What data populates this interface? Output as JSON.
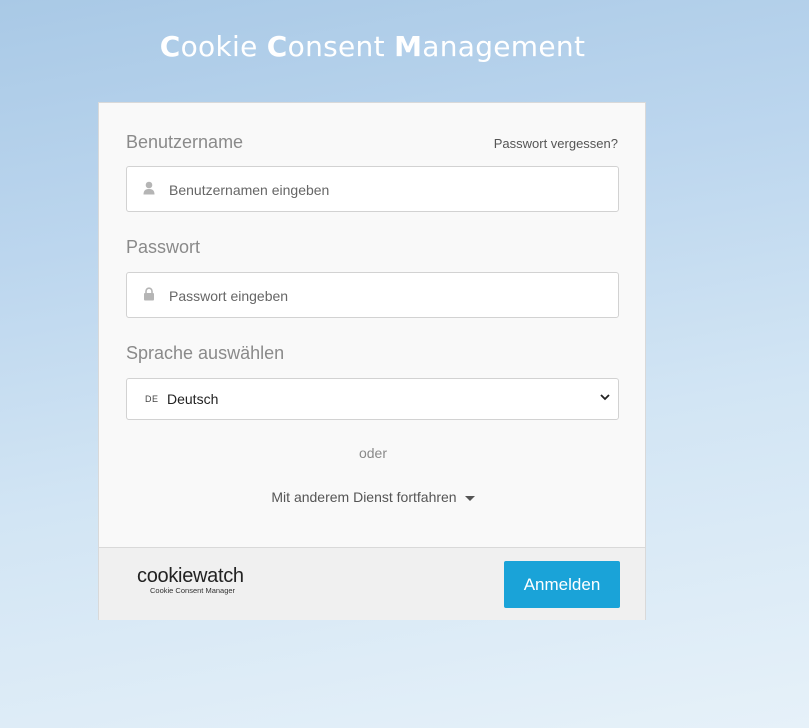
{
  "header": {
    "title_parts": [
      {
        "bold": "C",
        "rest": "ookie "
      },
      {
        "bold": "C",
        "rest": "onsent "
      },
      {
        "bold": "M",
        "rest": "anagement"
      }
    ]
  },
  "form": {
    "username_label": "Benutzername",
    "forgot_password": "Passwort vergessen?",
    "username_placeholder": "Benutzernamen eingeben",
    "password_label": "Passwort",
    "password_placeholder": "Passwort eingeben",
    "language_label": "Sprache auswählen",
    "language_flag": "DE",
    "language_value": "Deutsch",
    "or_text": "oder",
    "other_service": "Mit anderem Dienst fortfahren"
  },
  "footer": {
    "logo_main": "cookiewatch",
    "logo_sub": "Cookie Consent Manager",
    "login_button": "Anmelden",
    "button_color": "#1aa3d8"
  }
}
